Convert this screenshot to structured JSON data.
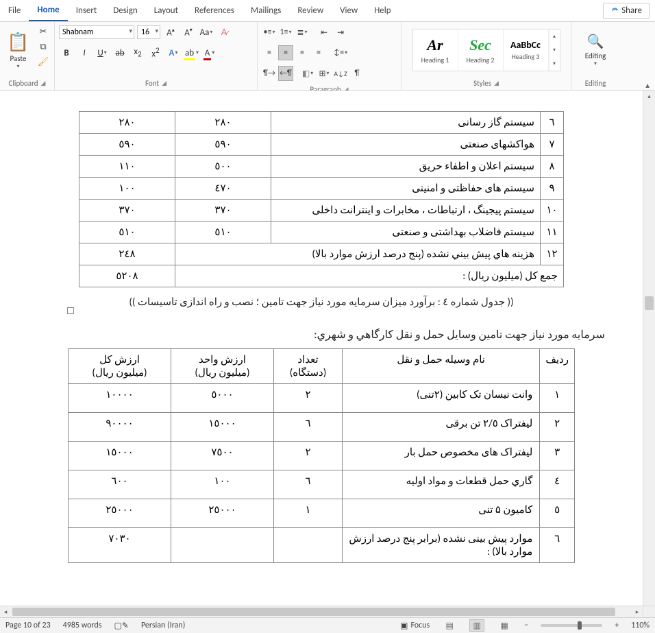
{
  "menu": {
    "tabs": [
      "File",
      "Home",
      "Insert",
      "Design",
      "Layout",
      "References",
      "Mailings",
      "Review",
      "View",
      "Help"
    ],
    "active": 1,
    "share": "Share"
  },
  "ribbon": {
    "clipboard": {
      "label": "Clipboard",
      "paste": "Paste"
    },
    "font": {
      "label": "Font",
      "name": "Shabnam",
      "size": "16"
    },
    "paragraph": {
      "label": "Paragraph"
    },
    "styles": {
      "label": "Styles",
      "items": [
        {
          "preview": "Ar",
          "name": "Heading 1",
          "color": "#000",
          "italic": true
        },
        {
          "preview": "Sec",
          "name": "Heading 2",
          "color": "#1ea838",
          "italic": true
        },
        {
          "preview": "AaBbCc",
          "name": "Heading 3",
          "color": "#333",
          "italic": false
        }
      ]
    },
    "editing": {
      "label": "Editing",
      "button": "Editing"
    }
  },
  "table1": {
    "rows": [
      {
        "idx": "٦",
        "desc": "سیستم گاز رسانی",
        "c1": "٢٨٠",
        "c2": "٢٨٠"
      },
      {
        "idx": "٧",
        "desc": "هواکشهای صنعتی",
        "c1": "٥٩٠",
        "c2": "٥٩٠"
      },
      {
        "idx": "٨",
        "desc": "سیستم اعلان و اطفاء حریق",
        "c1": "٥٠٠",
        "c2": "١١٠"
      },
      {
        "idx": "٩",
        "desc": "سیستم های حفاظتی و امنیتی",
        "c1": "٤٧٠",
        "c2": "١٠٠"
      },
      {
        "idx": "١٠",
        "desc": "سیستم پیجینگ ، ارتباطات ، مخابرات و اینترانت داخلی",
        "c1": "٣٧٠",
        "c2": "٣٧٠"
      },
      {
        "idx": "١١",
        "desc": "سیستم فاضلاب بهداشتی و صنعتی",
        "c1": "٥١٠",
        "c2": "٥١٠"
      },
      {
        "idx": "١٢",
        "desc": "هزينه هاي پيش بيني نشده (پنج درصد ارزش موارد بالا)",
        "c1": "",
        "c2": "٢٤٨"
      }
    ],
    "total_label": "جمع کل (میلیون ریال) :",
    "total_value": "٥٢٠٨"
  },
  "caption1": "(( جدول شماره ٤ : برآورد میزان سرمایه مورد نیاز جهت تامین ؛ نصب و راه اندازی تاسیسات ))",
  "heading2": "سرمايه مورد نياز جهت تامين وسايل حمل و نقل كارگاهي و شهري:",
  "table2": {
    "headers": {
      "idx": "ردیف",
      "name": "نام وسیله حمل و نقل",
      "qty": "تعداد",
      "qty2": "(دستگاه)",
      "unit": "ارزش واحد",
      "unit2": "(میلیون ریال)",
      "total": "ارزش کل",
      "total2": "(میلیون ریال)"
    },
    "rows": [
      {
        "idx": "١",
        "name": "وانت نیسان تک کابین (٢تنی)",
        "qty": "٢",
        "unit": "٥٠٠٠",
        "total": "١٠٠٠٠"
      },
      {
        "idx": "٢",
        "name": "لیفتراک ٢/٥ تن برقی",
        "qty": "٦",
        "unit": "١٥٠٠٠",
        "total": "٩٠٠٠٠"
      },
      {
        "idx": "٣",
        "name": "لیفتراک های مخصوص حمل بار",
        "qty": "٢",
        "unit": "٧٥٠٠",
        "total": "١٥٠٠٠"
      },
      {
        "idx": "٤",
        "name": "گاري حمل قطعات و مواد اوليه",
        "qty": "٦",
        "unit": "١٠٠",
        "total": "٦٠٠"
      },
      {
        "idx": "٥",
        "name": "کامیون ۵ تنی",
        "qty": "١",
        "unit": "٢٥٠٠٠",
        "total": "٢٥٠٠٠"
      },
      {
        "idx": "٦",
        "name": "موارد پیش بینی نشده (برابر پنج درصد ارزش موارد بالا) :",
        "qty": "",
        "unit": "",
        "total": "٧٠٣٠"
      }
    ]
  },
  "status": {
    "page": "Page 10 of 23",
    "words": "4985 words",
    "lang": "Persian (Iran)",
    "focus": "Focus",
    "zoom": "110%"
  }
}
